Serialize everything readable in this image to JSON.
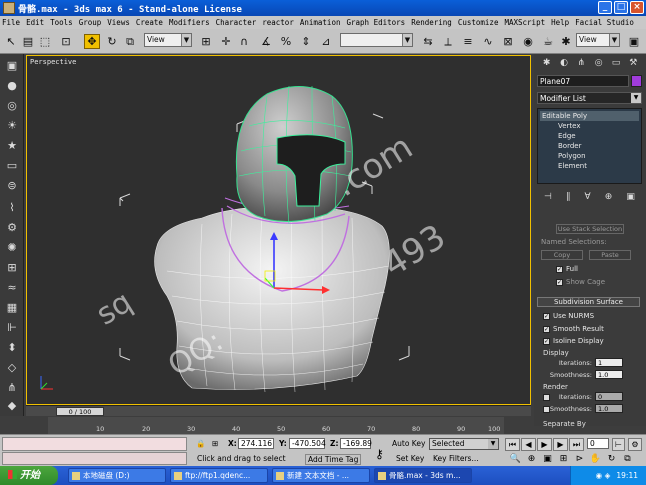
{
  "window": {
    "title": "骨骼.max - 3ds max 6 - Stand-alone License"
  },
  "menu": [
    "File",
    "Edit",
    "Tools",
    "Group",
    "Views",
    "Create",
    "Modifiers",
    "Character",
    "reactor",
    "Animation",
    "Graph Editors",
    "Rendering",
    "Customize",
    "MAXScript",
    "Help",
    "Facial Studio"
  ],
  "toolbar": {
    "view_select": "View",
    "view_select2": "View"
  },
  "viewport": {
    "label": "Perspective",
    "watermark_1": "sq",
    "watermark_2": "QQ:",
    "watermark_3": ".com",
    "watermark_4": "493"
  },
  "command_panel": {
    "object_name": "Plane07",
    "object_color": "#a03cdc",
    "modifier_list": "Modifier List",
    "stack": {
      "top": "Editable Poly",
      "subs": [
        "Vertex",
        "Edge",
        "Border",
        "Polygon",
        "Element"
      ]
    },
    "named_selections": "Named Selections:",
    "use_stack_button": "Use Stack Selection",
    "copy_button": "Copy",
    "paste_button": "Paste",
    "full_label": "Full",
    "show_cage_label": "Show Cage",
    "subdiv_title": "Subdivision Surface",
    "use_nurms": "Use NURMS",
    "smooth_result": "Smooth Result",
    "isoline_display": "Isoline Display",
    "display_label": "Display",
    "iterations_label": "Iterations:",
    "iterations_value": "1",
    "smoothness_label": "Smoothness:",
    "smoothness_value": "1.0",
    "render_label": "Render",
    "render_iterations_value": "0",
    "render_smoothness_value": "1.0",
    "separate_by": "Separate By"
  },
  "timeline": {
    "frame_display": "0 / 100",
    "ticks": [
      "10",
      "20",
      "30",
      "40",
      "50",
      "60",
      "70",
      "80",
      "90",
      "100"
    ]
  },
  "status": {
    "x_label": "X:",
    "x_value": "274.116",
    "y_label": "Y:",
    "y_value": "-470.504",
    "z_label": "Z:",
    "z_value": "-169.89",
    "auto_key": "Auto Key",
    "selected": "Selected",
    "set_key": "Set Key",
    "key_filters": "Key Filters...",
    "prompt": "Click and drag to select",
    "add_time_tag": "Add Time Tag",
    "frame_field": "0"
  },
  "taskbar": {
    "start": "开始",
    "tasks": [
      "本地磁盘 (D:)",
      "ftp://ftp1.qdenc...",
      "新建 文本文档 - ...",
      "骨骼.max - 3ds m..."
    ],
    "clock": "19:11"
  }
}
